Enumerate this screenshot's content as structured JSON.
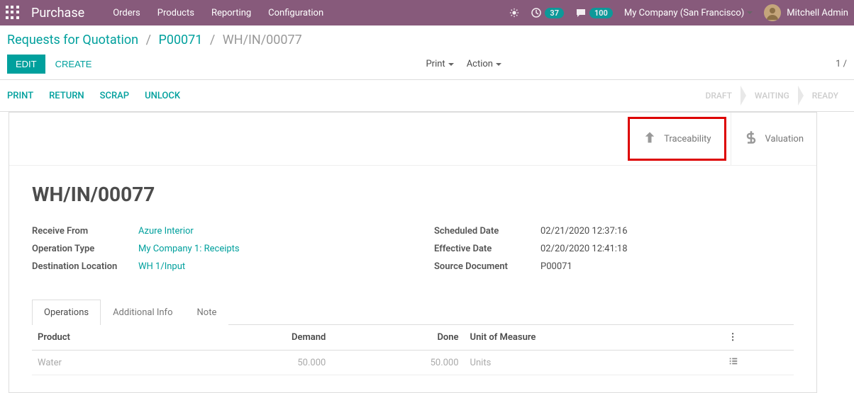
{
  "topbar": {
    "app_title": "Purchase",
    "menu": [
      "Orders",
      "Products",
      "Reporting",
      "Configuration"
    ],
    "activity_count": "37",
    "message_count": "100",
    "company": "My Company (San Francisco)",
    "user_name": "Mitchell Admin"
  },
  "breadcrumb": {
    "root": "Requests for Quotation",
    "parent": "P00071",
    "current": "WH/IN/00077"
  },
  "controls": {
    "edit": "EDIT",
    "create": "CREATE",
    "print": "Print",
    "action": "Action",
    "pager": "1 /"
  },
  "actions": {
    "print": "PRINT",
    "return": "RETURN",
    "scrap": "SCRAP",
    "unlock": "UNLOCK"
  },
  "status": {
    "draft": "DRAFT",
    "waiting": "WAITING",
    "ready": "READY"
  },
  "stat_buttons": {
    "traceability": "Traceability",
    "valuation": "Valuation"
  },
  "record": {
    "title": "WH/IN/00077",
    "labels": {
      "receive_from": "Receive From",
      "operation_type": "Operation Type",
      "destination_location": "Destination Location",
      "scheduled_date": "Scheduled Date",
      "effective_date": "Effective Date",
      "source_document": "Source Document"
    },
    "values": {
      "receive_from": "Azure Interior",
      "operation_type": "My Company 1: Receipts",
      "destination_location": "WH 1/Input",
      "scheduled_date": "02/21/2020 12:37:16",
      "effective_date": "02/20/2020 12:41:18",
      "source_document": "P00071"
    }
  },
  "tabs": {
    "operations": "Operations",
    "additional_info": "Additional Info",
    "note": "Note"
  },
  "table": {
    "headers": {
      "product": "Product",
      "demand": "Demand",
      "done": "Done",
      "uom": "Unit of Measure"
    },
    "rows": [
      {
        "product": "Water",
        "demand": "50.000",
        "done": "50.000",
        "uom": "Units"
      }
    ]
  }
}
